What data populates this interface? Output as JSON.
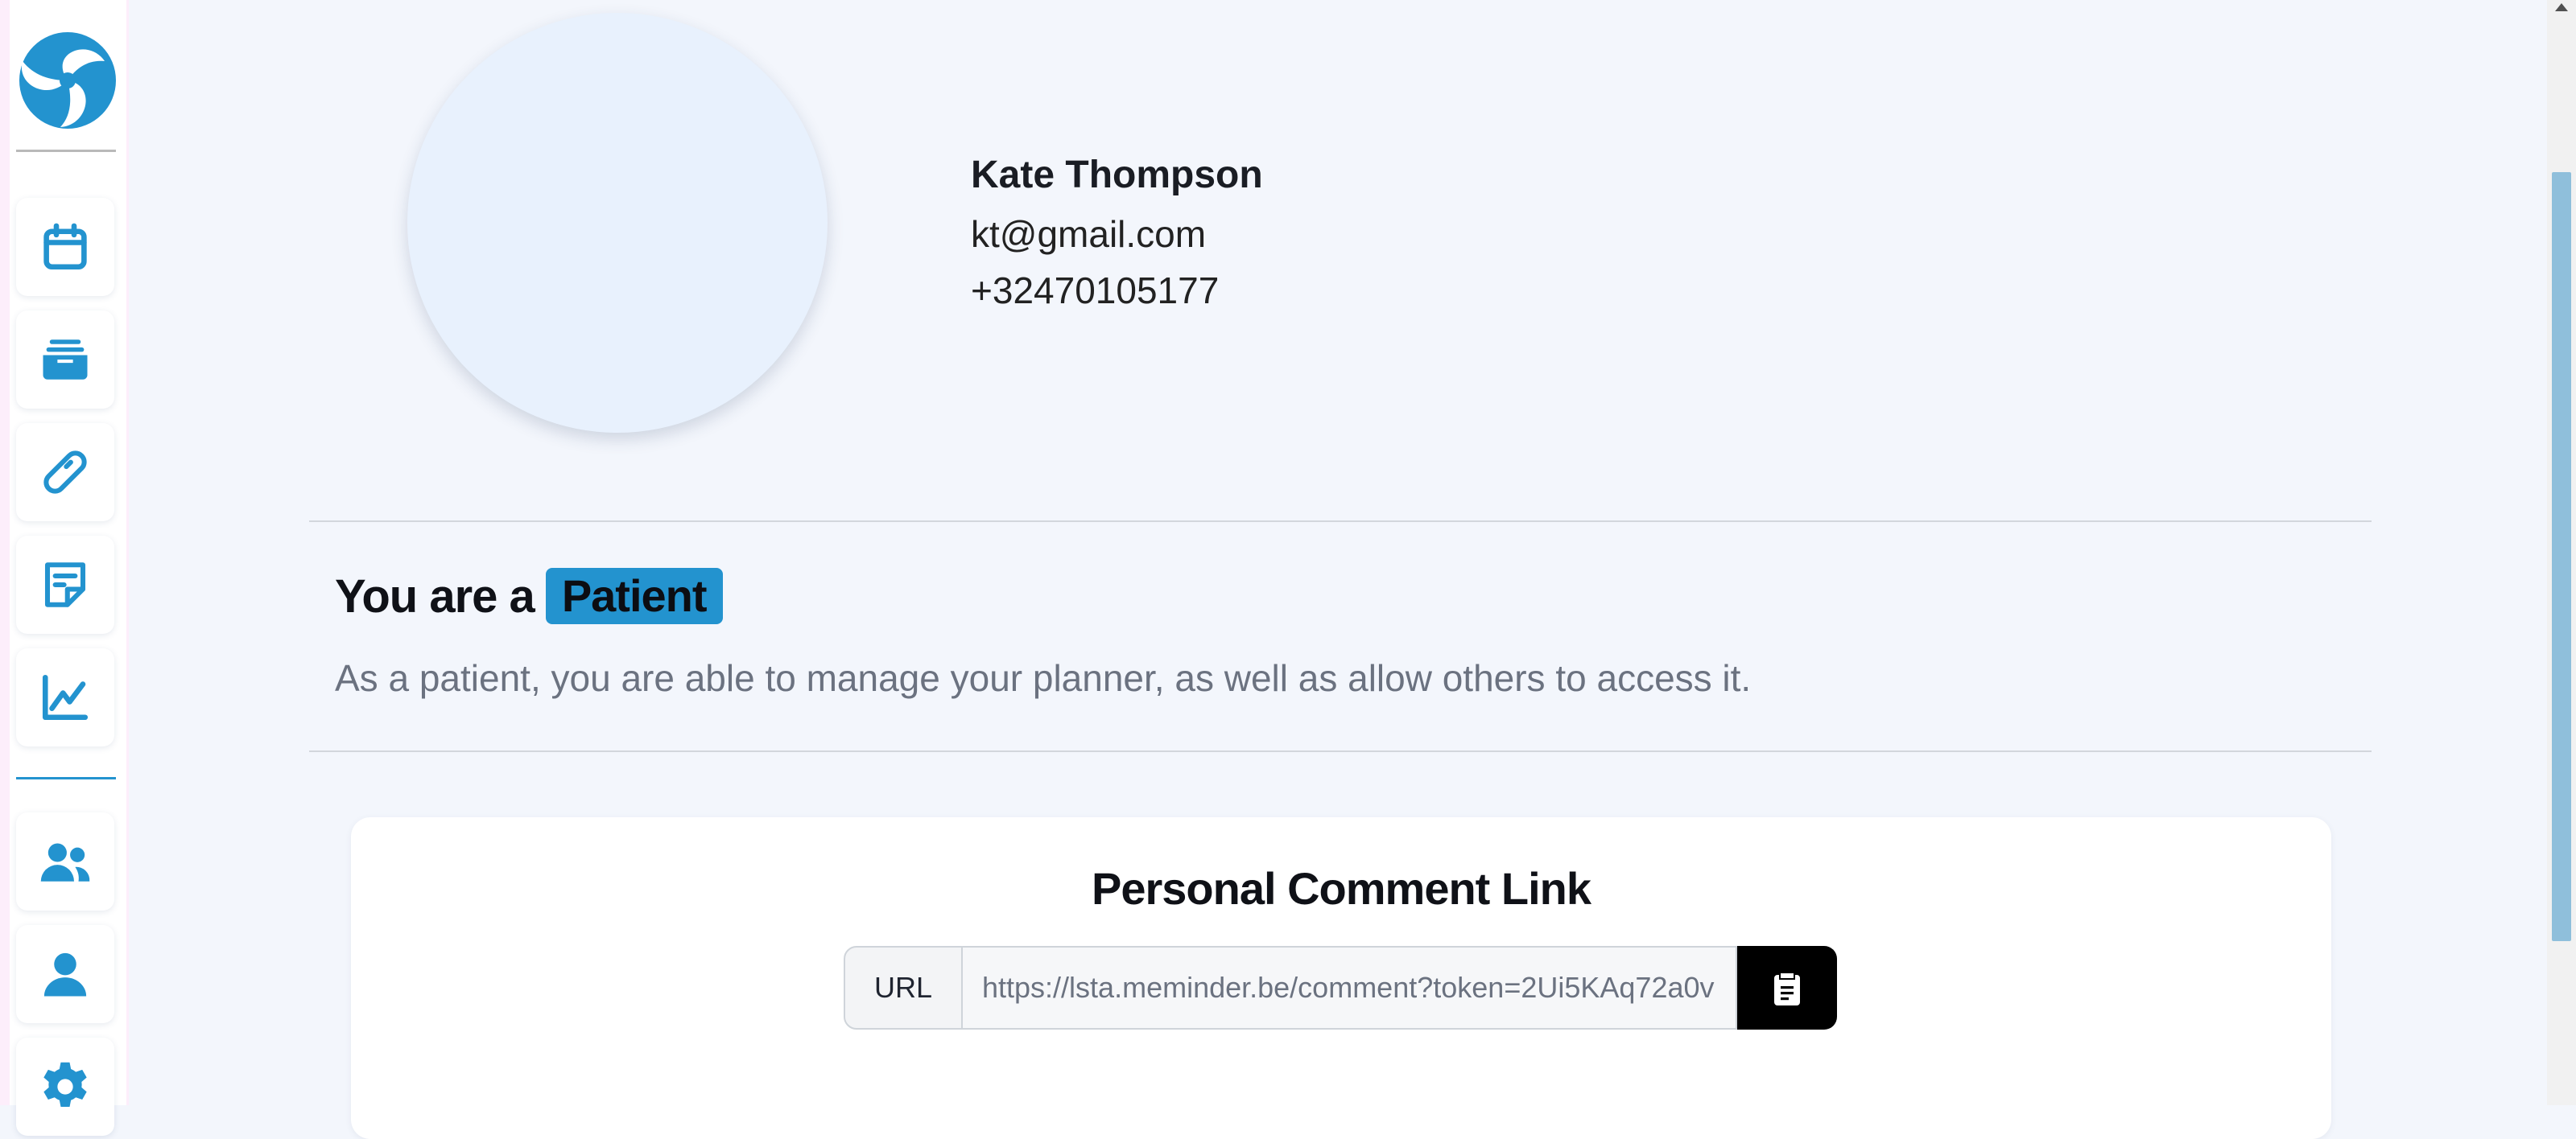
{
  "sidebar": {
    "logo_icon": "orbit-logo-icon",
    "items": [
      {
        "icon": "calendar-icon"
      },
      {
        "icon": "inbox-icon"
      },
      {
        "icon": "pill-icon"
      },
      {
        "icon": "note-icon"
      },
      {
        "icon": "chart-line-icon"
      },
      {
        "icon": "users-icon"
      },
      {
        "icon": "user-icon"
      },
      {
        "icon": "gear-icon"
      }
    ],
    "accent_color": "#2393cf"
  },
  "profile": {
    "name": "Kate Thompson",
    "email": "kt@gmail.com",
    "phone": "+32470105177"
  },
  "role": {
    "title_prefix": "You are a",
    "badge": "Patient",
    "description": "As a patient, you are able to manage your planner, as well as allow others to access it."
  },
  "comment_link": {
    "title": "Personal Comment Link",
    "label": "URL",
    "value": "https://lsta.meminder.be/comment?token=2Ui5KAq72a0v",
    "copy_icon": "clipboard-icon"
  }
}
